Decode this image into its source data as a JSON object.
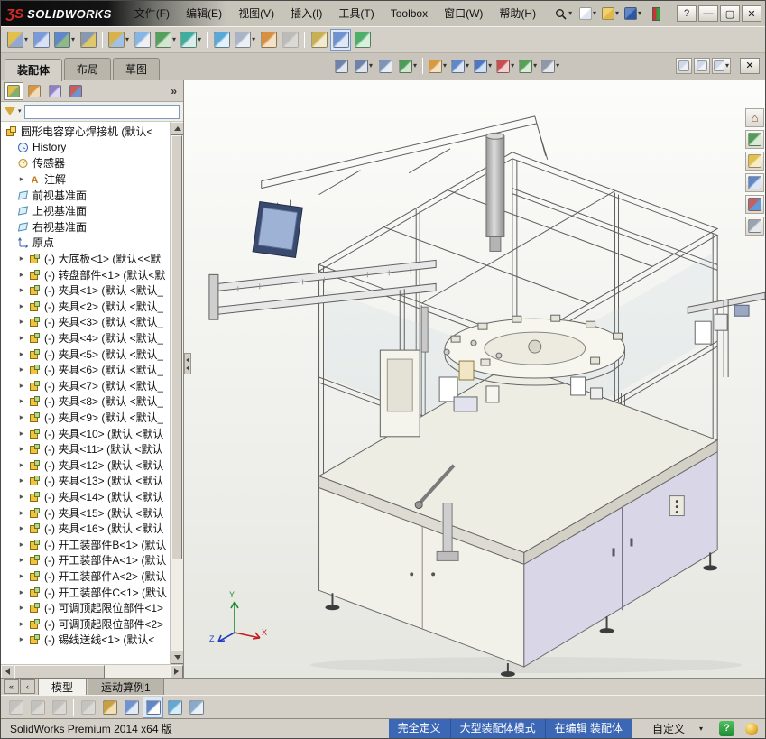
{
  "titlebar": {
    "logo_mark": "ƷS",
    "logo_text": "SOLIDWORKS",
    "menus": [
      {
        "key": "file",
        "label": "文件(F)"
      },
      {
        "key": "edit",
        "label": "编辑(E)"
      },
      {
        "key": "view",
        "label": "视图(V)"
      },
      {
        "key": "insert",
        "label": "插入(I)"
      },
      {
        "key": "tools",
        "label": "工具(T)"
      },
      {
        "key": "toolbox",
        "label": "Toolbox"
      },
      {
        "key": "window",
        "label": "窗口(W)"
      },
      {
        "key": "help",
        "label": "帮助(H)"
      }
    ],
    "quick_icons": [
      {
        "name": "new-document-icon",
        "c1": "#ffffff",
        "c2": "#dfe6f0",
        "dd": true
      },
      {
        "name": "open-document-icon",
        "c1": "#f0d070",
        "c2": "#dfb84a",
        "dd": true
      },
      {
        "name": "save-icon",
        "c1": "#5f87c9",
        "c2": "#2f57a0",
        "dd": true
      }
    ]
  },
  "ui_glyphs": {
    "dropdown": "▾",
    "expand": "▸",
    "overflow": "»",
    "scroll_left": "◀",
    "scroll_right": "▶",
    "scroll_up": "▲",
    "scroll_down": "▼",
    "tab_first": "«",
    "tab_prev": "‹",
    "close": "✕",
    "minimize": "—",
    "maximize": "▢",
    "help": "?"
  },
  "main_toolbar": [
    {
      "name": "insert-components-icon",
      "c1": "#e3c04a",
      "c2": "#8fa8d8",
      "dd": true
    },
    {
      "name": "mate-icon",
      "c1": "#7a9ad8",
      "c2": "#d8e2f4"
    },
    {
      "name": "linear-component-pattern-icon",
      "c1": "#5f87c9",
      "c2": "#8fba84",
      "dd": true
    },
    {
      "name": "smart-fasteners-icon",
      "c1": "#8898b2",
      "c2": "#e0c86a"
    },
    {
      "sep": true
    },
    {
      "name": "move-component-icon",
      "c1": "#d9b24a",
      "c2": "#9fc0e8",
      "dd": true
    },
    {
      "name": "show-hidden-components-icon",
      "c1": "#86b6e4",
      "c2": "#f0f0f0"
    },
    {
      "name": "assembly-features-icon",
      "c1": "#55a05c",
      "c2": "#d2e6d2",
      "dd": true
    },
    {
      "name": "reference-geometry-icon",
      "c1": "#3fae9e",
      "c2": "#daeee9",
      "dd": true
    },
    {
      "sep": true
    },
    {
      "name": "new-motion-study-icon",
      "c1": "#58a8d8",
      "c2": "#e4f0fa"
    },
    {
      "name": "bill-of-materials-icon",
      "c1": "#aab4c6",
      "c2": "#ecf0f6",
      "dd": true
    },
    {
      "name": "exploded-view-icon",
      "c1": "#d88f3f",
      "c2": "#f4e2c8"
    },
    {
      "name": "explode-line-sketch-icon",
      "c1": "#9aa4b0",
      "c2": "#e0e4ea",
      "disabled": true
    },
    {
      "sep": true
    },
    {
      "name": "instant3d-icon",
      "c1": "#c8b052",
      "c2": "#f0ead0"
    },
    {
      "name": "large-assembly-mode-icon",
      "c1": "#6f93d0",
      "c2": "#dfe8f6",
      "active": true
    },
    {
      "name": "rebuild-icon",
      "c1": "#4fae6a",
      "c2": "#d8f0de"
    }
  ],
  "command_tabs": [
    {
      "key": "assembly",
      "label": "装配体",
      "active": true
    },
    {
      "key": "layout",
      "label": "布局"
    },
    {
      "key": "sketch",
      "label": "草图"
    }
  ],
  "headsup_toolbar": [
    {
      "name": "zoom-fit-icon",
      "c1": "#6f83a8",
      "c2": "#dfe6f0"
    },
    {
      "name": "zoom-area-icon",
      "c1": "#6f83a8",
      "c2": "#dfe6f0",
      "dd": true
    },
    {
      "name": "previous-view-icon",
      "c1": "#7f95b8",
      "c2": "#e8eef6"
    },
    {
      "name": "section-view-icon",
      "c1": "#4f9b57",
      "c2": "#d2e6d2",
      "dd": true
    },
    {
      "sep": true
    },
    {
      "name": "view-orientation-icon",
      "c1": "#d89a3f",
      "c2": "#f2e2c8",
      "dd": true
    },
    {
      "name": "display-style-icon",
      "c1": "#5f87c9",
      "c2": "#dce6f4",
      "dd": true
    },
    {
      "name": "hide-show-items-icon",
      "c1": "#4f78c0",
      "c2": "#cfe0f4",
      "dd": true
    },
    {
      "name": "edit-appearance-icon",
      "c1": "#c84f4f",
      "c2": "#f0d2d2",
      "dd": true
    },
    {
      "name": "apply-scene-icon",
      "c1": "#58a058",
      "c2": "#d8ecd8",
      "dd": true
    },
    {
      "name": "view-settings-icon",
      "c1": "#9098a8",
      "c2": "#e4e8ee",
      "dd": true
    }
  ],
  "doc_controls": [
    {
      "name": "viewport-pane-left-icon",
      "c1": "#cfd8ea",
      "c2": "#eef2f8"
    },
    {
      "name": "viewport-pane-split-icon",
      "c1": "#cfd8ea",
      "c2": "#eef2f8"
    },
    {
      "name": "viewport-pane-full-icon",
      "c1": "#cfd8ea",
      "c2": "#eef2f8",
      "dd": true
    }
  ],
  "left_panel": {
    "tabs": [
      {
        "name": "featuremanager-tab-icon",
        "c1": "#e3c04a",
        "c2": "#7fb070",
        "active": true
      },
      {
        "name": "propertymanager-tab-icon",
        "c1": "#d8973f",
        "c2": "#f0ddc0"
      },
      {
        "name": "configurationmanager-tab-icon",
        "c1": "#8f7fc8",
        "c2": "#ded8f0"
      },
      {
        "name": "displaymanager-tab-icon",
        "c1": "#c85f5f",
        "c2": "#6f93d0"
      }
    ],
    "filter_value": ""
  },
  "feature_tree": {
    "root": "圆形电容穿心焊接机 (默认<",
    "items": [
      {
        "type": "history",
        "label": "History",
        "arrow": false
      },
      {
        "type": "sensors",
        "label": "传感器",
        "arrow": false
      },
      {
        "type": "annotations",
        "label": "注解",
        "arrow": true
      },
      {
        "type": "plane",
        "label": "前视基准面",
        "arrow": false
      },
      {
        "type": "plane",
        "label": "上视基准面",
        "arrow": false
      },
      {
        "type": "plane",
        "label": "右视基准面",
        "arrow": false
      },
      {
        "type": "origin",
        "label": "原点",
        "arrow": false
      },
      {
        "type": "component",
        "label": "(-) 大底板<1> (默认<<默",
        "arrow": true
      },
      {
        "type": "component",
        "label": "(-) 转盘部件<1> (默认<默",
        "arrow": true
      },
      {
        "type": "component",
        "label": "(-) 夹具<1> (默认 <默认_",
        "arrow": true
      },
      {
        "type": "component",
        "label": "(-) 夹具<2> (默认 <默认_",
        "arrow": true
      },
      {
        "type": "component",
        "label": "(-) 夹具<3> (默认 <默认_",
        "arrow": true
      },
      {
        "type": "component",
        "label": "(-) 夹具<4> (默认 <默认_",
        "arrow": true
      },
      {
        "type": "component",
        "label": "(-) 夹具<5> (默认 <默认_",
        "arrow": true
      },
      {
        "type": "component",
        "label": "(-) 夹具<6> (默认 <默认_",
        "arrow": true
      },
      {
        "type": "component",
        "label": "(-) 夹具<7> (默认 <默认_",
        "arrow": true
      },
      {
        "type": "component",
        "label": "(-) 夹具<8> (默认 <默认_",
        "arrow": true
      },
      {
        "type": "component",
        "label": "(-) 夹具<9> (默认 <默认_",
        "arrow": true
      },
      {
        "type": "component",
        "label": "(-) 夹具<10> (默认 <默认",
        "arrow": true
      },
      {
        "type": "component",
        "label": "(-) 夹具<11> (默认 <默认",
        "arrow": true
      },
      {
        "type": "component",
        "label": "(-) 夹具<12> (默认 <默认",
        "arrow": true
      },
      {
        "type": "component",
        "label": "(-) 夹具<13> (默认 <默认",
        "arrow": true
      },
      {
        "type": "component",
        "label": "(-) 夹具<14> (默认 <默认",
        "arrow": true
      },
      {
        "type": "component",
        "label": "(-) 夹具<15> (默认 <默认",
        "arrow": true
      },
      {
        "type": "component",
        "label": "(-) 夹具<16> (默认 <默认",
        "arrow": true
      },
      {
        "type": "component",
        "label": "(-) 开工装部件B<1> (默认",
        "arrow": true
      },
      {
        "type": "component",
        "label": "(-) 开工装部件A<1> (默认",
        "arrow": true
      },
      {
        "type": "component",
        "label": "(-) 开工装部件A<2> (默认",
        "arrow": true
      },
      {
        "type": "component",
        "label": "(-) 开工装部件C<1> (默认",
        "arrow": true
      },
      {
        "type": "component",
        "label": "(-) 可调顶起限位部件<1>",
        "arrow": true
      },
      {
        "type": "component",
        "label": "(-) 可调顶起限位部件<2>",
        "arrow": true
      },
      {
        "type": "component",
        "label": "(-) 锡线送线<1> (默认<",
        "arrow": true
      }
    ]
  },
  "viewport": {
    "triad": [
      "X",
      "Y",
      "Z"
    ]
  },
  "task_pane": {
    "tabs": [
      {
        "name": "home-tab-icon",
        "glyph": "⌂",
        "color": "#7a4f2f"
      },
      {
        "name": "design-library-tab-icon",
        "c1": "#4f9b57",
        "c2": "#d8ecd8"
      },
      {
        "name": "file-explorer-tab-icon",
        "c1": "#e3c04a",
        "c2": "#f6ecc8"
      },
      {
        "name": "view-palette-tab-icon",
        "c1": "#5f87c9",
        "c2": "#dce6f6"
      },
      {
        "name": "appearances-tab-icon",
        "c1": "#c85f5f",
        "c2": "#5f9bd8"
      },
      {
        "name": "custom-properties-tab-icon",
        "c1": "#9aa4b0",
        "c2": "#e6eaee"
      }
    ]
  },
  "bottom_tabs": [
    {
      "key": "model",
      "label": "模型",
      "active": true
    },
    {
      "key": "motion-study-1",
      "label": "运动算例1"
    }
  ],
  "bottom_toolbar": [
    {
      "name": "select-tool-icon",
      "c1": "#b0b0b0",
      "c2": "#e6e6e6",
      "disabled": true
    },
    {
      "name": "drag-assembly-icon",
      "c1": "#b0b0b0",
      "c2": "#e6e6e6",
      "disabled": true
    },
    {
      "name": "rotate-component-icon",
      "c1": "#b0b0b0",
      "c2": "#e6e6e6",
      "disabled": true
    },
    {
      "sep": true
    },
    {
      "name": "hide-show-bodies-icon",
      "c1": "#cab860",
      "c2": "#eee8c8",
      "disabled": true
    },
    {
      "name": "assembly-xpert-icon",
      "c1": "#c8a040",
      "c2": "#f0e0b8"
    },
    {
      "name": "isolate-icon",
      "c1": "#6f93d0",
      "c2": "#e2eaf8"
    },
    {
      "name": "display-pane-icon",
      "c1": "#5f87c9",
      "c2": "#ffffff",
      "active": true
    },
    {
      "name": "appearance-target-icon",
      "c1": "#5fa8d8",
      "c2": "#d8ecf8"
    },
    {
      "name": "view-selector-icon",
      "c1": "#88aacc",
      "c2": "#e8f0f8"
    }
  ],
  "statusbar": {
    "product": "SolidWorks Premium 2014 x64 版",
    "segments": [
      "完全定义",
      "大型装配体模式",
      "在编辑 装配体"
    ],
    "custom": "自定义",
    "help_glyph": "?"
  }
}
